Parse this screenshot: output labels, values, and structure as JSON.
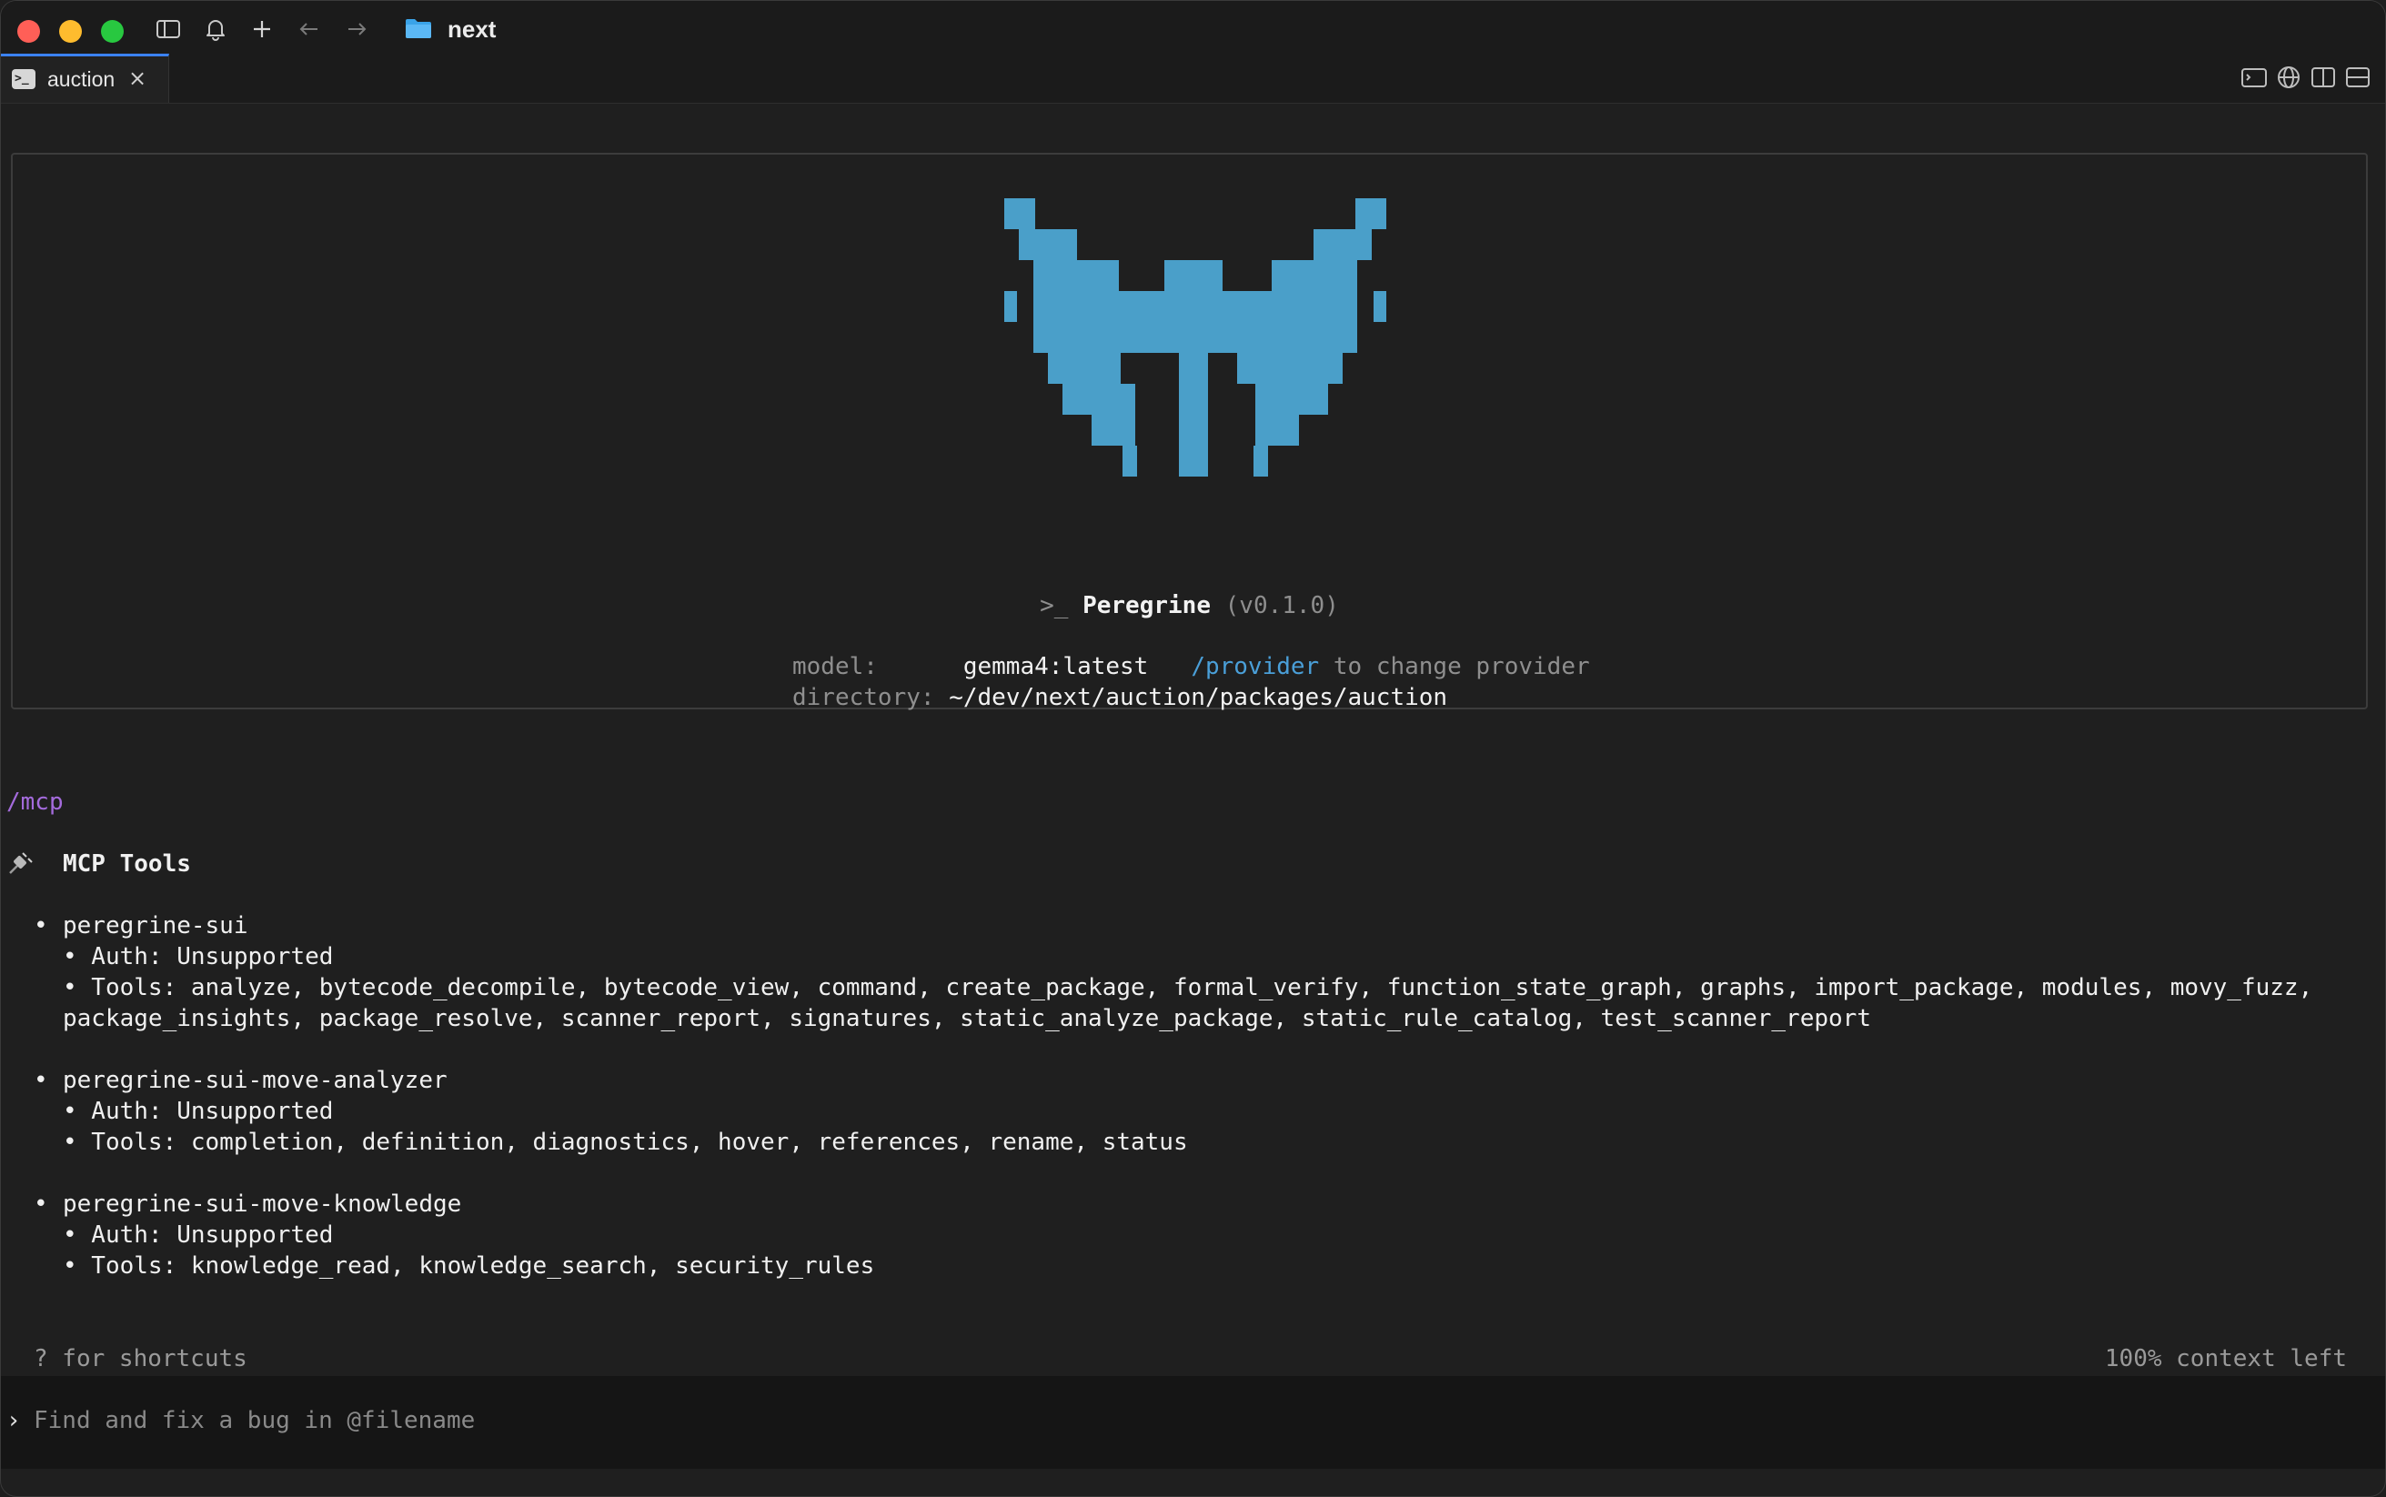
{
  "titlebar": {
    "title": "next",
    "icons": [
      "sidebar-toggle-icon",
      "bell-icon",
      "plus-icon",
      "arrow-left-icon",
      "arrow-right-icon",
      "folder-icon"
    ]
  },
  "tab": {
    "label": "auction",
    "close": "×"
  },
  "tabbar_right_icons": [
    "terminal-icon",
    "globe-icon",
    "split-vertical-icon",
    "split-horizontal-icon"
  ],
  "banner": {
    "prompt_symbol": ">_",
    "product_name": "Peregrine",
    "version": "(v0.1.0)",
    "model_label": "model:",
    "model_value": "gemma4:latest",
    "provider_command": "/provider",
    "provider_hint": "to change provider",
    "directory_label": "directory:",
    "directory_value": "~/dev/next/auction/packages/auction",
    "logo_color": "#4a9fc9"
  },
  "session": {
    "command": "/mcp",
    "section_title": "MCP Tools",
    "servers": [
      {
        "name": "peregrine-sui",
        "auth": "• Auth: Unsupported",
        "tools_line1": "• Tools: analyze, bytecode_decompile, bytecode_view, command, create_package, formal_verify, function_state_graph, graphs, import_package, modules, movy_fuzz,",
        "tools_line2": "package_insights, package_resolve, scanner_report, signatures, static_analyze_package, static_rule_catalog, test_scanner_report"
      },
      {
        "name": "peregrine-sui-move-analyzer",
        "auth": "• Auth: Unsupported",
        "tools_line1": "• Tools: completion, definition, diagnostics, hover, references, rename, status"
      },
      {
        "name": "peregrine-sui-move-knowledge",
        "auth": "• Auth: Unsupported",
        "tools_line1": "• Tools: knowledge_read, knowledge_search, security_rules"
      }
    ],
    "bullet": "•"
  },
  "footer": {
    "shortcuts_hint": "? for shortcuts",
    "context_left": "100% context left"
  },
  "input": {
    "caret": "›",
    "placeholder": "Find and fix a bug in @filename",
    "value": ""
  },
  "colors": {
    "accent_blue": "#3b82f6",
    "command_purple": "#a46bdc",
    "link_blue": "#4a9fd8"
  }
}
